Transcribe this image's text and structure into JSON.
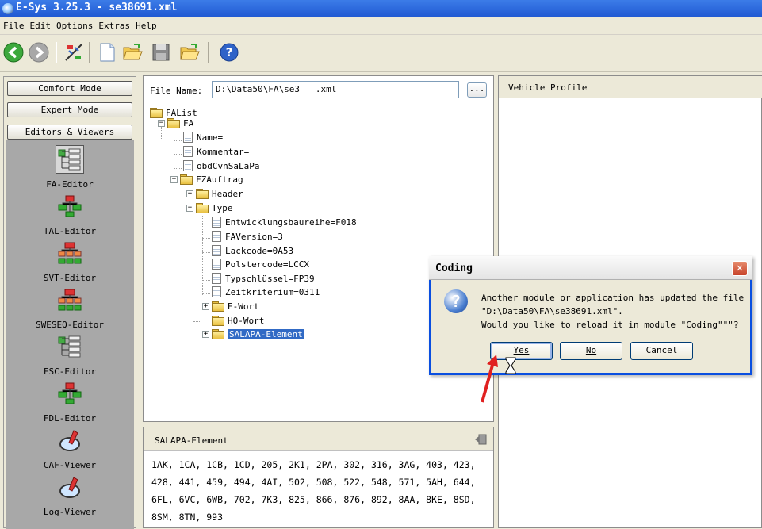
{
  "window": {
    "title": "E-Sys 3.25.3 - se38691.xml"
  },
  "menu": [
    "File",
    "Edit",
    "Options",
    "Extras",
    "Help"
  ],
  "toolbar": {
    "icons": [
      "back-icon",
      "forward-icon",
      "connect-icon",
      "new-file-icon",
      "open-folder-icon",
      "save-icon",
      "open-folder-2-icon",
      "help-icon"
    ]
  },
  "sidebar": {
    "modes": [
      "Comfort Mode",
      "Expert Mode",
      "Editors & Viewers"
    ],
    "editors": [
      "FA-Editor",
      "TAL-Editor",
      "SVT-Editor",
      "SWESEQ-Editor",
      "FSC-Editor",
      "FDL-Editor",
      "CAF-Viewer",
      "Log-Viewer"
    ]
  },
  "file": {
    "label": "File Name:",
    "value": "D:\\Data50\\FA\\se3   .xml",
    "browse": "..."
  },
  "tree": {
    "root": "FAList",
    "fa": "FA",
    "name": "Name=",
    "kommentar": "Kommentar=",
    "obd": "obdCvnSaLaPa",
    "fzauftrag": "FZAuftrag",
    "header": "Header",
    "type": "Type",
    "entw": "Entwicklungsbaureihe=F018",
    "faversion": "FAVersion=3",
    "lack": "Lackcode=0A53",
    "polster": "Polstercode=LCCX",
    "typschl": "Typschlüssel=FP39",
    "zeit": "Zeitkriterium=0311",
    "ewort": "E-Wort",
    "howort": "HO-Wort",
    "salapa": "SALAPA-Element"
  },
  "salapa_panel": {
    "title": "SALAPA-Element",
    "text": "1AK, 1CA, 1CB, 1CD, 205, 2K1, 2PA, 302, 316, 3AG, 403, 423, 428, 441, 459, 494, 4AI, 502, 508, 522, 548, 571, 5AH, 644, 6FL, 6VC, 6WB, 702, 7K3, 825, 866, 876, 892, 8AA, 8KE, 8SD, 8SM, 8TN, 993"
  },
  "vehicle_profile": {
    "title": "Vehicle Profile"
  },
  "dialog": {
    "title": "Coding",
    "line1": "Another module or application has updated the file",
    "line2": "\"D:\\Data50\\FA\\se38691.xml\".",
    "line3": "Would you like to reload it in module \"Coding\"\"\"?",
    "yes": "Yes",
    "no": "No",
    "cancel": "Cancel"
  }
}
